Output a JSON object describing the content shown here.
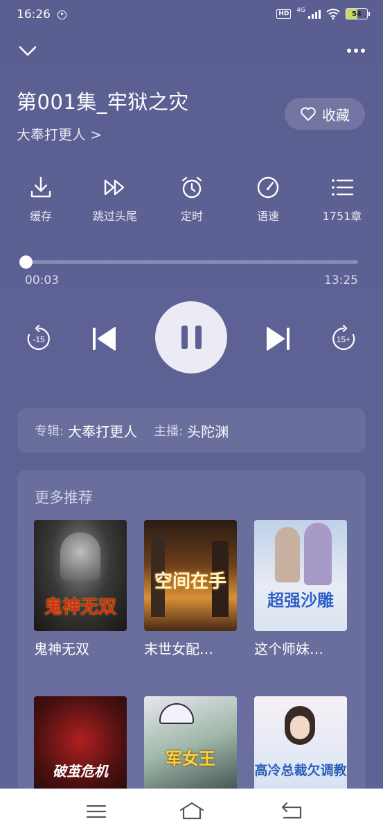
{
  "status_bar": {
    "time": "16:26",
    "network": "4G",
    "hd": "HD",
    "battery": "54"
  },
  "episode": {
    "title": "第001集_牢狱之灾",
    "album_link": "大奉打更人 >"
  },
  "favorite": {
    "label": "收藏"
  },
  "tools": [
    {
      "label": "缓存",
      "icon": "download-icon"
    },
    {
      "label": "跳过头尾",
      "icon": "fast-forward-icon"
    },
    {
      "label": "定时",
      "icon": "alarm-clock-icon"
    },
    {
      "label": "语速",
      "icon": "speedometer-icon"
    },
    {
      "label": "1751章",
      "icon": "list-icon"
    }
  ],
  "player": {
    "current_time": "00:03",
    "total_time": "13:25",
    "progress": 0.004,
    "rewind_label": "-15",
    "forward_label": "15+"
  },
  "info": {
    "album_key": "专辑:",
    "album_value": "大奉打更人",
    "host_key": "主播:",
    "host_value": "头陀渊"
  },
  "recommend": {
    "title": "更多推荐",
    "books": [
      {
        "name": "鬼神无双",
        "cover_text": "鬼神无双"
      },
      {
        "name": "末世女配…",
        "cover_text": "空间在手"
      },
      {
        "name": "这个师妹…",
        "cover_text": "超强沙雕"
      },
      {
        "name": "",
        "cover_text": "破茧危机"
      },
      {
        "name": "",
        "cover_text": "军女王"
      },
      {
        "name": "",
        "cover_text": "高冷总裁欠调教"
      }
    ]
  }
}
